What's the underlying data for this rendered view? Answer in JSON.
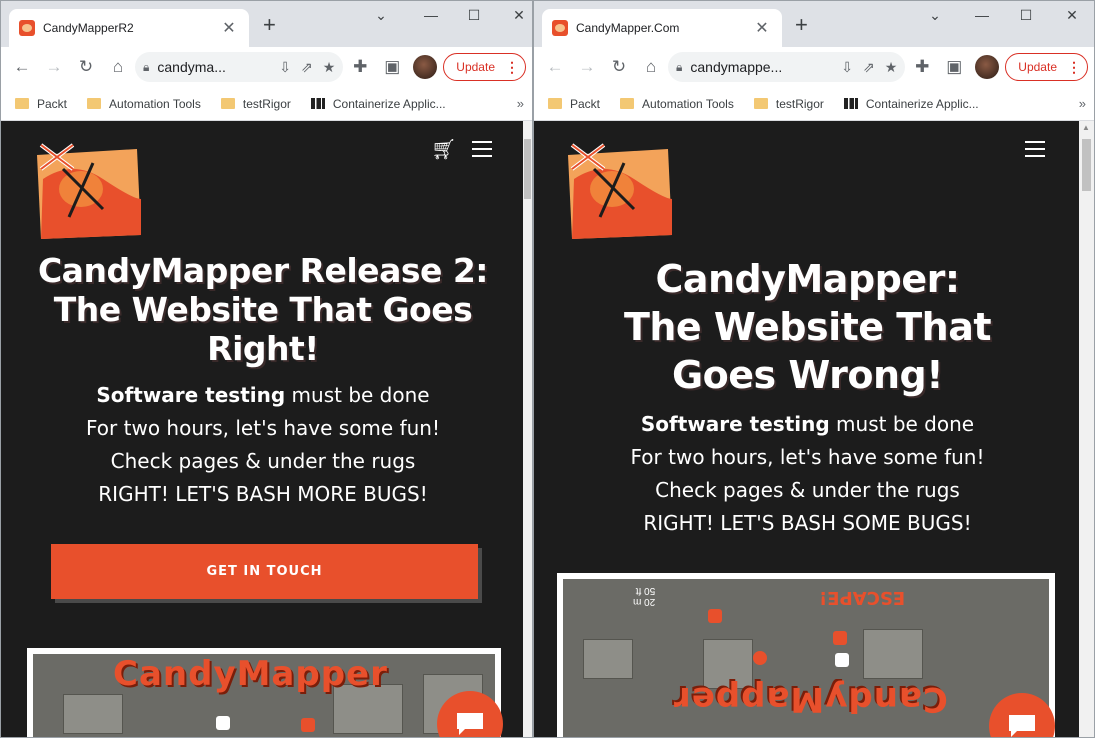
{
  "left": {
    "tab_title": "CandyMapperR2",
    "url": "candyma...",
    "update_label": "Update",
    "bookmarks": [
      "Packt",
      "Automation Tools",
      "testRigor",
      "Containerize Applic..."
    ],
    "headline": [
      "CandyMapper Release 2:",
      "The Website That Goes",
      "Right!"
    ],
    "poem_bold": "Software testing",
    "poem_rest": " must be done",
    "poem_lines": [
      "For two hours, let's have some fun!",
      "Check pages & under the rugs",
      "RIGHT! LET'S BASH MORE BUGS!"
    ],
    "cta_label": "GET IN TOUCH",
    "map_title": "CandyMapper"
  },
  "right": {
    "tab_title": "CandyMapper.Com",
    "url": "candymappe...",
    "update_label": "Update",
    "bookmarks": [
      "Packt",
      "Automation Tools",
      "testRigor",
      "Containerize Applic..."
    ],
    "headline": [
      "CandyMapper:",
      "The Website That",
      "Goes Wrong!"
    ],
    "poem_bold": "Software testing",
    "poem_rest": " must be done",
    "poem_lines": [
      "For two hours, let's have some fun!",
      "Check pages & under the rugs",
      "RIGHT! LET'S BASH SOME BUGS!"
    ],
    "map_title": "CandyMapper",
    "map_escape": "ESCAPE!",
    "map_scale": [
      "20 m",
      "50 ft"
    ]
  },
  "colors": {
    "accent": "#e8502c",
    "page_bg": "#1c1c1c"
  },
  "icons": [
    "back-icon",
    "forward-icon",
    "reload-icon",
    "home-icon",
    "lock-icon",
    "install-icon",
    "share-icon",
    "star-icon",
    "extensions-icon",
    "sidepanel-icon",
    "cart-icon",
    "menu-icon",
    "chat-icon"
  ]
}
